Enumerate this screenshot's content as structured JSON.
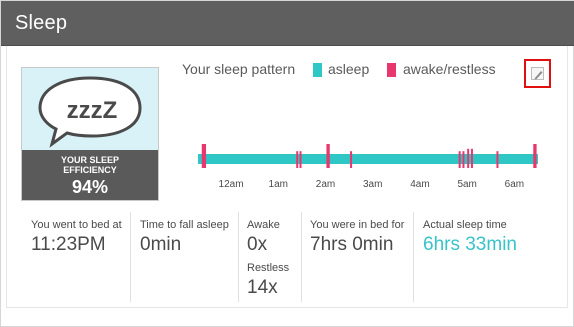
{
  "panel": {
    "title": "Sleep"
  },
  "efficiency": {
    "bubble_text": "zzzZ",
    "label": "YOUR SLEEP\nEFFICIENCY",
    "value": "94%",
    "percent": 94
  },
  "legend": {
    "title": "Your sleep pattern",
    "asleep_label": "asleep",
    "awake_label": "awake/restless",
    "asleep_color": "#2fc6c6",
    "awake_color": "#e8366e"
  },
  "edit_button": {
    "icon": "edit-icon"
  },
  "chart_data": {
    "type": "bar",
    "x_domain_hours": [
      23.3,
      30.5
    ],
    "tick_labels": [
      "12am",
      "1am",
      "2am",
      "3am",
      "4am",
      "5am",
      "6am"
    ],
    "tick_hours": [
      24,
      25,
      26,
      27,
      28,
      29,
      30
    ],
    "awake_segments": [
      {
        "start": 23.38,
        "end": 23.47,
        "height": 1.0
      },
      {
        "start": 25.38,
        "end": 25.4,
        "height": 0.7
      },
      {
        "start": 25.45,
        "end": 25.47,
        "height": 0.7
      },
      {
        "start": 26.02,
        "end": 26.09,
        "height": 1.0
      },
      {
        "start": 26.52,
        "end": 26.54,
        "height": 0.7
      },
      {
        "start": 28.82,
        "end": 28.84,
        "height": 0.7
      },
      {
        "start": 28.9,
        "end": 28.92,
        "height": 0.7
      },
      {
        "start": 29.0,
        "end": 29.04,
        "height": 0.8
      },
      {
        "start": 29.08,
        "end": 29.11,
        "height": 0.8
      },
      {
        "start": 29.62,
        "end": 29.64,
        "height": 0.7
      },
      {
        "start": 30.4,
        "end": 30.47,
        "height": 1.0
      }
    ]
  },
  "stats": [
    {
      "label": "You went to bed at",
      "value": "11:23PM"
    },
    {
      "label": "Time to fall asleep",
      "value": "0min"
    },
    {
      "label": "Awake",
      "value": "0x",
      "sub_label": "Restless",
      "sub_value": "14x"
    },
    {
      "label": "You were in bed for",
      "value": "7hrs 0min"
    },
    {
      "label": "Actual sleep time",
      "value": "6hrs 33min"
    }
  ]
}
